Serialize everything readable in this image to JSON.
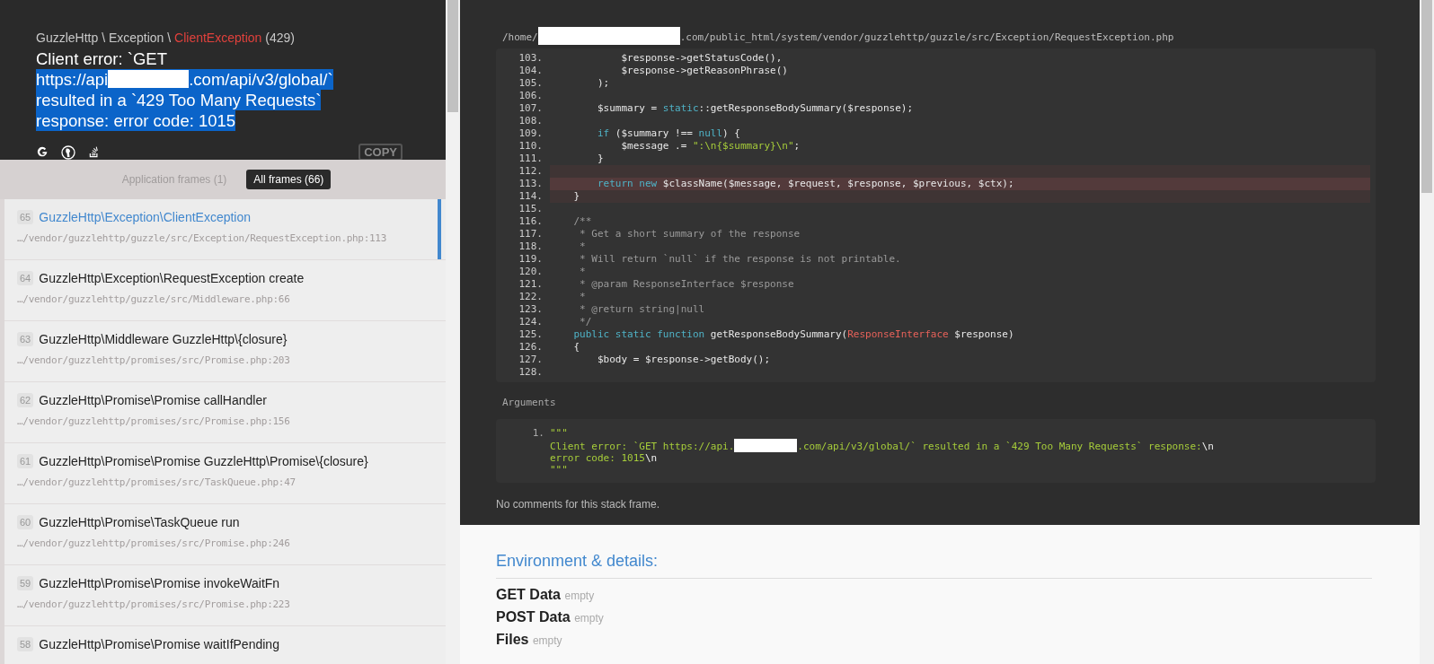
{
  "header": {
    "namespace": "GuzzleHttp \\ Exception \\ ",
    "class_name": "ClientException",
    "code": "(429)",
    "message": [
      {
        "selected": false,
        "parts": [
          {
            "kind": "text",
            "text": "Client error: `GET"
          }
        ]
      },
      {
        "selected": true,
        "parts": [
          {
            "kind": "text",
            "text": "https://api"
          },
          {
            "kind": "redaction"
          },
          {
            "kind": "text",
            "text": ".com/api/v3/global/`"
          }
        ]
      },
      {
        "selected": true,
        "parts": [
          {
            "kind": "text",
            "text": "resulted in a `429 Too Many Requests`"
          }
        ]
      },
      {
        "selected": true,
        "parts": [
          {
            "kind": "text",
            "text": "response: error code: 1015"
          }
        ]
      }
    ],
    "copy_button": "COPY"
  },
  "frame_tabs": [
    {
      "label": "Application frames (1)",
      "selected": false
    },
    {
      "label": "All frames (66)",
      "selected": true
    }
  ],
  "frames": [
    {
      "number": "65",
      "name": "GuzzleHttp\\Exception\\ClientException",
      "file": "…/vendor/guzzlehttp/guzzle/src/Exception/RequestException.php:113",
      "selected": true
    },
    {
      "number": "64",
      "name": "GuzzleHttp\\Exception\\RequestException create",
      "file": "…/vendor/guzzlehttp/guzzle/src/Middleware.php:66",
      "selected": false
    },
    {
      "number": "63",
      "name": "GuzzleHttp\\Middleware GuzzleHttp\\{closure}",
      "file": "…/vendor/guzzlehttp/promises/src/Promise.php:203",
      "selected": false
    },
    {
      "number": "62",
      "name": "GuzzleHttp\\Promise\\Promise callHandler",
      "file": "…/vendor/guzzlehttp/promises/src/Promise.php:156",
      "selected": false
    },
    {
      "number": "61",
      "name": "GuzzleHttp\\Promise\\Promise GuzzleHttp\\Promise\\{closure}",
      "file": "…/vendor/guzzlehttp/promises/src/TaskQueue.php:47",
      "selected": false
    },
    {
      "number": "60",
      "name": "GuzzleHttp\\Promise\\TaskQueue run",
      "file": "…/vendor/guzzlehttp/promises/src/Promise.php:246",
      "selected": false
    },
    {
      "number": "59",
      "name": "GuzzleHttp\\Promise\\Promise invokeWaitFn",
      "file": "…/vendor/guzzlehttp/promises/src/Promise.php:223",
      "selected": false
    },
    {
      "number": "58",
      "name": "GuzzleHttp\\Promise\\Promise waitIfPending",
      "selected": false
    }
  ],
  "file_path": [
    {
      "kind": "text",
      "text": "/home/"
    },
    {
      "kind": "redaction"
    },
    {
      "kind": "text",
      "text": ".com/public_html/system/vendor/guzzlehttp/guzzle/src/Exception/RequestException.php"
    }
  ],
  "code_lines": [
    {
      "number": "103.",
      "in_range": false,
      "error_line": false,
      "tokens": [
        {
          "kind": "plain",
          "text": "            $response->getStatusCode(),"
        }
      ]
    },
    {
      "number": "104.",
      "in_range": false,
      "error_line": false,
      "tokens": [
        {
          "kind": "plain",
          "text": "            $response->getReasonPhrase()"
        }
      ]
    },
    {
      "number": "105.",
      "in_range": false,
      "error_line": false,
      "tokens": [
        {
          "kind": "plain",
          "text": "        );"
        }
      ]
    },
    {
      "number": "106.",
      "in_range": false,
      "error_line": false
    },
    {
      "number": "107.",
      "in_range": false,
      "error_line": false,
      "tokens": [
        {
          "kind": "plain",
          "text": "        $summary = "
        },
        {
          "kind": "keyword",
          "text": "static"
        },
        {
          "kind": "plain",
          "text": "::getResponseBodySummary($response);"
        }
      ]
    },
    {
      "number": "108.",
      "in_range": false,
      "error_line": false
    },
    {
      "number": "109.",
      "in_range": false,
      "error_line": false,
      "tokens": [
        {
          "kind": "keyword",
          "text": "        if"
        },
        {
          "kind": "plain",
          "text": " ($summary !== "
        },
        {
          "kind": "keyword",
          "text": "null"
        },
        {
          "kind": "plain",
          "text": ") {"
        }
      ]
    },
    {
      "number": "110.",
      "in_range": false,
      "error_line": false,
      "tokens": [
        {
          "kind": "plain",
          "text": "            $message .= "
        },
        {
          "kind": "string",
          "text": "\":\\n{$summary}\\n\""
        },
        {
          "kind": "plain",
          "text": ";"
        }
      ]
    },
    {
      "number": "111.",
      "in_range": false,
      "error_line": false,
      "tokens": [
        {
          "kind": "plain",
          "text": "        }"
        }
      ]
    },
    {
      "number": "112.",
      "in_range": true,
      "error_line": false
    },
    {
      "number": "113.",
      "in_range": true,
      "error_line": true,
      "tokens": [
        {
          "kind": "keyword",
          "text": "        return new"
        },
        {
          "kind": "plain",
          "text": " $className($message, $request, $response, $previous, $ctx);"
        }
      ]
    },
    {
      "number": "114.",
      "in_range": true,
      "error_line": false,
      "tokens": [
        {
          "kind": "plain",
          "text": "    }"
        }
      ]
    },
    {
      "number": "115.",
      "in_range": false,
      "error_line": false
    },
    {
      "number": "116.",
      "in_range": false,
      "error_line": false,
      "tokens": [
        {
          "kind": "comment",
          "text": "    /**"
        }
      ]
    },
    {
      "number": "117.",
      "in_range": false,
      "error_line": false,
      "tokens": [
        {
          "kind": "comment",
          "text": "     * Get a short summary of the response"
        }
      ]
    },
    {
      "number": "118.",
      "in_range": false,
      "error_line": false,
      "tokens": [
        {
          "kind": "comment",
          "text": "     *"
        }
      ]
    },
    {
      "number": "119.",
      "in_range": false,
      "error_line": false,
      "tokens": [
        {
          "kind": "comment",
          "text": "     * Will return `null` if the response is not printable."
        }
      ]
    },
    {
      "number": "120.",
      "in_range": false,
      "error_line": false,
      "tokens": [
        {
          "kind": "comment",
          "text": "     *"
        }
      ]
    },
    {
      "number": "121.",
      "in_range": false,
      "error_line": false,
      "tokens": [
        {
          "kind": "comment",
          "text": "     * @param ResponseInterface $response"
        }
      ]
    },
    {
      "number": "122.",
      "in_range": false,
      "error_line": false,
      "tokens": [
        {
          "kind": "comment",
          "text": "     *"
        }
      ]
    },
    {
      "number": "123.",
      "in_range": false,
      "error_line": false,
      "tokens": [
        {
          "kind": "comment",
          "text": "     * @return string|null"
        }
      ]
    },
    {
      "number": "124.",
      "in_range": false,
      "error_line": false,
      "tokens": [
        {
          "kind": "comment",
          "text": "     */"
        }
      ]
    },
    {
      "number": "125.",
      "in_range": false,
      "error_line": false,
      "tokens": [
        {
          "kind": "keyword",
          "text": "    public static function"
        },
        {
          "kind": "plain",
          "text": " getResponseBodySummary("
        },
        {
          "kind": "type",
          "text": "ResponseInterface"
        },
        {
          "kind": "plain",
          "text": " $response)"
        }
      ]
    },
    {
      "number": "126.",
      "in_range": false,
      "error_line": false,
      "tokens": [
        {
          "kind": "plain",
          "text": "    {"
        }
      ]
    },
    {
      "number": "127.",
      "in_range": false,
      "error_line": false,
      "tokens": [
        {
          "kind": "plain",
          "text": "        $body = $response->getBody();"
        }
      ]
    },
    {
      "number": "128.",
      "in_range": false,
      "error_line": false
    }
  ],
  "arguments": {
    "title": "Arguments",
    "items": [
      {
        "index": "1.",
        "lines": [
          [
            {
              "kind": "string",
              "text": "\"\"\""
            }
          ],
          [
            {
              "kind": "string",
              "text": "Client error: `GET https://api."
            },
            {
              "kind": "redaction"
            },
            {
              "kind": "string",
              "text": ".com/api/v3/global/` resulted in a `429 Too Many Requests` response:"
            },
            {
              "kind": "escape",
              "text": "\\n"
            }
          ],
          [
            {
              "kind": "string",
              "text": "error code: 1015"
            },
            {
              "kind": "escape",
              "text": "\\n"
            }
          ],
          [
            {
              "kind": "string",
              "text": "\"\"\""
            }
          ]
        ]
      }
    ]
  },
  "comments": "No comments for this stack frame.",
  "environment": {
    "title": "Environment & details:",
    "sections": [
      {
        "label": "GET Data",
        "value": "empty"
      },
      {
        "label": "POST Data",
        "value": "empty"
      },
      {
        "label": "Files",
        "value": "empty"
      }
    ]
  }
}
